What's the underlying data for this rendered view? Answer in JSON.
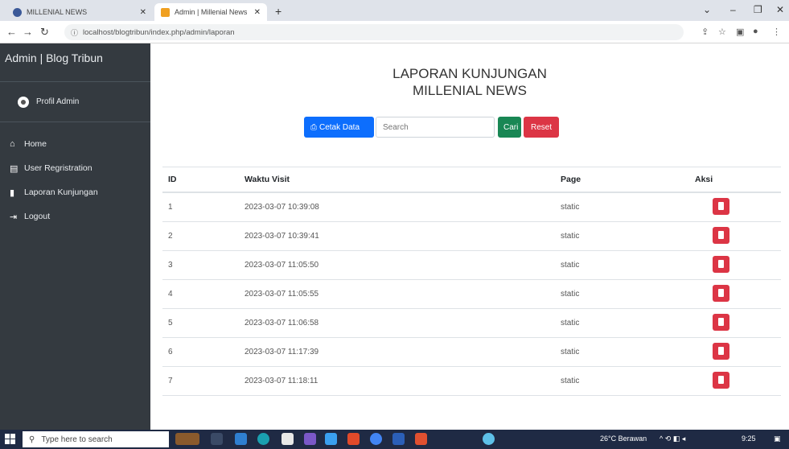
{
  "browser": {
    "tabs": [
      {
        "label": "MILLENIAL NEWS"
      },
      {
        "label": "Admin | Millenial News"
      }
    ],
    "new_tab": "+",
    "url": "localhost/blogtribun/index.php/admin/laporan"
  },
  "sidebar": {
    "brand": "Admin | Blog Tribun",
    "profile": "Profil Admin",
    "items": [
      {
        "label": "Home",
        "icon": "home-icon"
      },
      {
        "label": "User Regristration",
        "icon": "id-card-icon"
      },
      {
        "label": "Laporan Kunjungan",
        "icon": "bookmark-icon"
      },
      {
        "label": "Logout",
        "icon": "logout-icon"
      }
    ]
  },
  "main": {
    "title_line1": "LAPORAN KUNJUNGAN",
    "title_line2": "MILLENIAL NEWS",
    "print_label": "Cetak Data",
    "search_placeholder": "Search",
    "search_button": "Cari",
    "reset_button": "Reset",
    "table": {
      "headers": {
        "id": "ID",
        "waktu": "Waktu Visit",
        "page": "Page",
        "aksi": "Aksi"
      },
      "rows": [
        {
          "id": "1",
          "waktu": "2023-03-07 10:39:08",
          "page": "static"
        },
        {
          "id": "2",
          "waktu": "2023-03-07 10:39:41",
          "page": "static"
        },
        {
          "id": "3",
          "waktu": "2023-03-07 11:05:50",
          "page": "static"
        },
        {
          "id": "4",
          "waktu": "2023-03-07 11:05:55",
          "page": "static"
        },
        {
          "id": "5",
          "waktu": "2023-03-07 11:06:58",
          "page": "static"
        },
        {
          "id": "6",
          "waktu": "2023-03-07 11:17:39",
          "page": "static"
        },
        {
          "id": "7",
          "waktu": "2023-03-07 11:18:11",
          "page": "static"
        }
      ]
    }
  },
  "taskbar": {
    "search_placeholder": "Type here to search",
    "weather": "26°C Berawan",
    "time": "9:25"
  },
  "colors": {
    "sidebar_bg": "#343a40",
    "primary": "#0d6efd",
    "success": "#198754",
    "danger": "#dc3545"
  }
}
